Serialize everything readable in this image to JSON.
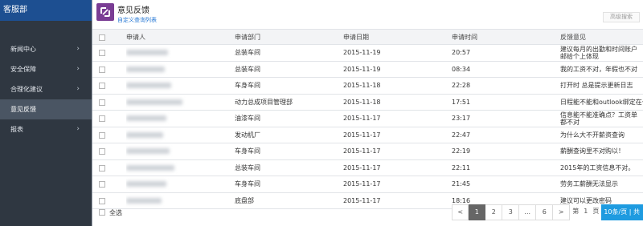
{
  "sidebar": {
    "title": "客服部",
    "items": [
      {
        "label": "新闻中心",
        "has_arrow": true
      },
      {
        "label": "安全保障",
        "has_arrow": true
      },
      {
        "label": "合理化建议",
        "has_arrow": true
      },
      {
        "label": "意见反馈",
        "has_arrow": false,
        "active": true
      },
      {
        "label": "报表",
        "has_arrow": true
      }
    ]
  },
  "header": {
    "title": "意见反馈",
    "custom_link": "自定义查询列表",
    "advanced_search": "高级搜索",
    "app_icon_color": "#7a3d94"
  },
  "table": {
    "columns": [
      "申请人",
      "申请部门",
      "申请日期",
      "申请时间",
      "反馈意见"
    ],
    "rows": [
      {
        "dept": "总装车间",
        "date": "2015-11-19",
        "time": "20:57",
        "feedback": "建议每月的出勤和时间账户邮给个上体现"
      },
      {
        "dept": "总装车间",
        "date": "2015-11-19",
        "time": "08:34",
        "feedback": "我的工资不对，年假也不对"
      },
      {
        "dept": "车身车间",
        "date": "2015-11-18",
        "time": "22:28",
        "feedback": "打开时 总是提示更新日志"
      },
      {
        "dept": "动力总成项目管理部",
        "date": "2015-11-18",
        "time": "17:51",
        "feedback": "日程能不能和outlook绑定在一"
      },
      {
        "dept": "油漆车间",
        "date": "2015-11-17",
        "time": "23:17",
        "feedback": "信息能不能准确点？工资单都不对"
      },
      {
        "dept": "发动机厂",
        "date": "2015-11-17",
        "time": "22:47",
        "feedback": "为什么大不开薪资查询"
      },
      {
        "dept": "车身车间",
        "date": "2015-11-17",
        "time": "22:19",
        "feedback": "薪酬查询里不对购以！"
      },
      {
        "dept": "总装车间",
        "date": "2015-11-17",
        "time": "22:11",
        "feedback": "2015年的工资信息不对。"
      },
      {
        "dept": "车身车间",
        "date": "2015-11-17",
        "time": "21:45",
        "feedback": "劳务工薪酬无法显示"
      },
      {
        "dept": "底盘部",
        "date": "2015-11-17",
        "time": "18:16",
        "feedback": "建议可以更改密码"
      }
    ]
  },
  "footer": {
    "select_all": "全选",
    "pager": {
      "prev": "<",
      "pages": [
        "1",
        "2",
        "3",
        "...",
        "6"
      ],
      "current": "1",
      "next": ">",
      "goto_prefix": "第",
      "goto_value": "1",
      "goto_suffix": "页",
      "page_size": "10条/页 | 共"
    }
  },
  "colors": {
    "sidebar_bg": "#2f3741",
    "sidebar_head_bg": "#1d4f91",
    "link": "#2a7ad5",
    "page_size_bg": "#1e9be0"
  }
}
